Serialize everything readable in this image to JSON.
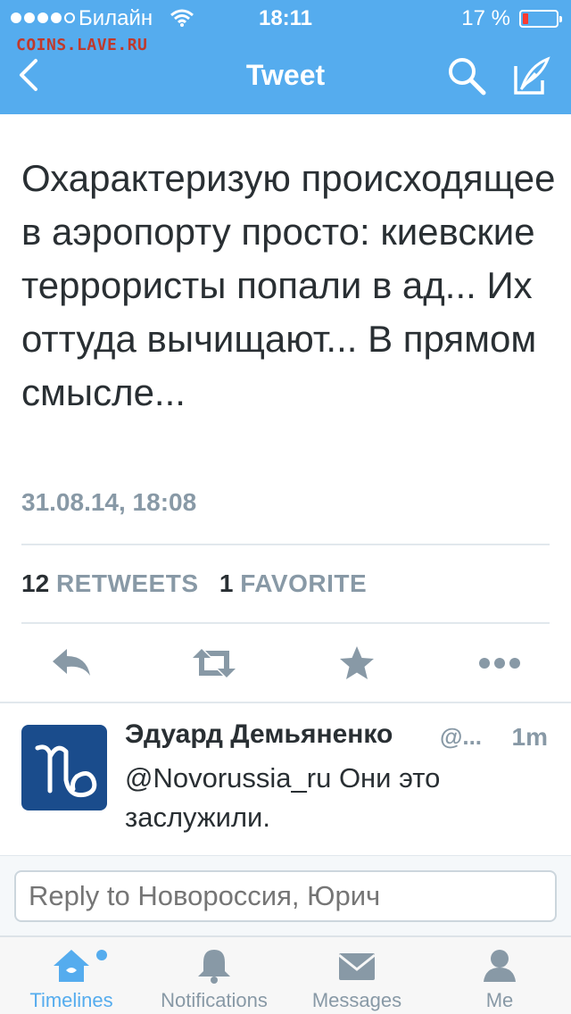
{
  "status_bar": {
    "carrier": "Билайн",
    "time": "18:11",
    "battery_percent": "17 %",
    "battery_level": 0.17
  },
  "watermark": "COINS.LAVE.RU",
  "nav": {
    "title": "Tweet"
  },
  "tweet": {
    "text": "Охарактеризую происходящее в аэропорту просто: киевские террористы попали в ад... Их оттуда вычищают... В прямом смысле...",
    "date": "31.08.14, 18:08",
    "retweets_count": "12",
    "retweets_label": "RETWEETS",
    "favorites_count": "1",
    "favorites_label": "FAVORITE"
  },
  "reply": {
    "author": "Эдуард Демьяненко",
    "handle": "@...",
    "time": "1m",
    "text": "@Novorussia_ru Они это заслужили."
  },
  "compose": {
    "placeholder": "Reply to Новороссия, Юрич"
  },
  "tabs": [
    {
      "label": "Timelines",
      "icon": "home-icon",
      "active": true
    },
    {
      "label": "Notifications",
      "icon": "bell-icon",
      "active": false
    },
    {
      "label": "Messages",
      "icon": "envelope-icon",
      "active": false
    },
    {
      "label": "Me",
      "icon": "person-icon",
      "active": false
    }
  ],
  "colors": {
    "brand": "#55acee",
    "text": "#292f33",
    "muted": "#8899a6",
    "battery_low": "#ff3b30"
  }
}
